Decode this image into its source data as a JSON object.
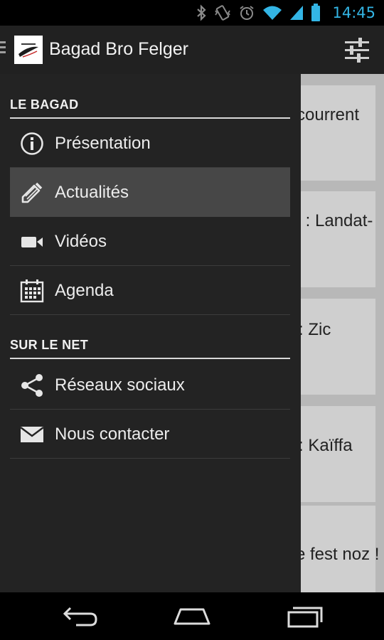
{
  "status_bar": {
    "time": "14:45",
    "icons": [
      "bluetooth-icon",
      "vibrate-icon",
      "alarm-icon",
      "wifi-icon",
      "signal-icon",
      "battery-icon"
    ],
    "color": "#33b5e5"
  },
  "action_bar": {
    "title": "Bagad Bro Felger",
    "logo": "app-logo-icon",
    "action_icon": "settings-sliders-icon"
  },
  "content_cards": [
    {
      "text": "courrent"
    },
    {
      "text": "z : Landat-"
    },
    {
      "text": ": Zic"
    },
    {
      "text": ": Kaïffa"
    },
    {
      "text": "e fest noz !"
    }
  ],
  "drawer": {
    "sections": [
      {
        "title": "LE BAGAD",
        "items": [
          {
            "label": "Présentation",
            "icon": "info-icon",
            "active": false
          },
          {
            "label": "Actualités",
            "icon": "pencil-icon",
            "active": true
          },
          {
            "label": "Vidéos",
            "icon": "video-camera-icon",
            "active": false
          },
          {
            "label": "Agenda",
            "icon": "calendar-icon",
            "active": false
          }
        ]
      },
      {
        "title": "SUR LE NET",
        "items": [
          {
            "label": "Réseaux sociaux",
            "icon": "share-icon",
            "active": false
          },
          {
            "label": "Nous contacter",
            "icon": "mail-icon",
            "active": false
          }
        ]
      }
    ]
  },
  "nav_bar": {
    "buttons": [
      "back-icon",
      "home-icon",
      "recent-apps-icon"
    ]
  }
}
